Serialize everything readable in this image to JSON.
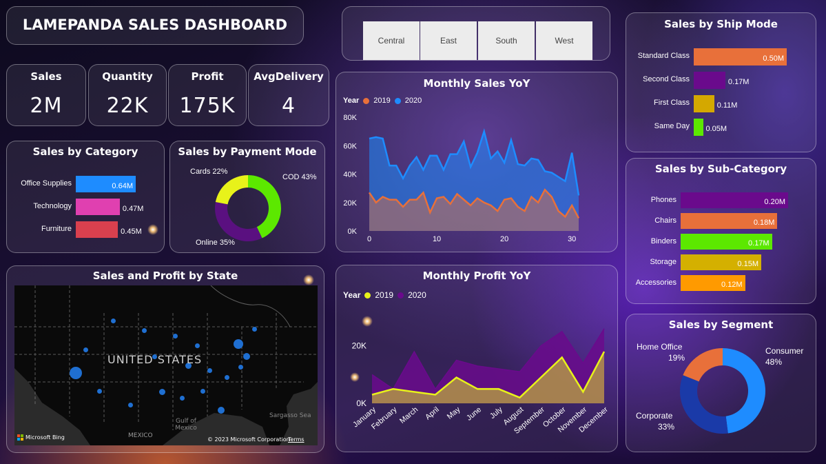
{
  "title": "LAMEPANDA SALES DASHBOARD",
  "regions": [
    "Central",
    "East",
    "South",
    "West"
  ],
  "kpis": [
    {
      "label": "Sales",
      "value": "2M"
    },
    {
      "label": "Quantity",
      "value": "22K"
    },
    {
      "label": "Profit",
      "value": "175K"
    },
    {
      "label": "AvgDelivery",
      "value": "4"
    }
  ],
  "colors": {
    "accent_orange": "#e8703a",
    "accent_blue": "#1e8cff",
    "accent_yellow": "#e8f21a",
    "accent_purple": "#6a0a8c"
  },
  "map": {
    "title": "Sales and Profit by State",
    "country_label": "UNITED STATES",
    "labels": [
      "Gulf of Mexico",
      "Sargasso Sea",
      "MEXICO"
    ],
    "brand": "Microsoft Bing",
    "copyright": "© 2023 Microsoft Corporation",
    "terms": "Terms"
  },
  "chart_data": [
    {
      "id": "category",
      "type": "bar",
      "title": "Sales by Category",
      "categories": [
        "Office Supplies",
        "Technology",
        "Furniture"
      ],
      "values": [
        0.64,
        0.47,
        0.45
      ],
      "labels": [
        "0.64M",
        "0.47M",
        "0.45M"
      ],
      "colors": [
        "#1e8cff",
        "#e040b0",
        "#d9404e"
      ]
    },
    {
      "id": "payment",
      "type": "pie",
      "title": "Sales by Payment Mode",
      "categories": [
        "COD",
        "Online",
        "Cards"
      ],
      "values": [
        43,
        35,
        22
      ],
      "labels": [
        "COD 43%",
        "Online 35%",
        "Cards 22%"
      ],
      "colors": [
        "#5ce800",
        "#5a1080",
        "#e8f21a"
      ]
    },
    {
      "id": "monthly_sales",
      "type": "area",
      "title": "Monthly Sales YoY",
      "legend_title": "Year",
      "x": [
        0,
        1,
        2,
        3,
        4,
        5,
        6,
        7,
        8,
        9,
        10,
        11,
        12,
        13,
        14,
        15,
        16,
        17,
        18,
        19,
        20,
        21,
        22,
        23,
        24,
        25,
        26,
        27,
        28,
        29,
        30,
        31
      ],
      "xticks": [
        "0",
        "10",
        "20",
        "30"
      ],
      "yticks": [
        "0K",
        "20K",
        "40K",
        "60K",
        "80K"
      ],
      "ylim": [
        0,
        80
      ],
      "xlim": [
        0,
        31
      ],
      "series": [
        {
          "name": "2019",
          "color": "#e8703a",
          "values": [
            27,
            20,
            24,
            22,
            22,
            17,
            22,
            22,
            27,
            13,
            23,
            24,
            19,
            26,
            22,
            18,
            23,
            20,
            18,
            14,
            22,
            23,
            17,
            14,
            24,
            20,
            29,
            24,
            14,
            10,
            18,
            9
          ]
        },
        {
          "name": "2020",
          "color": "#1e8cff",
          "values": [
            65,
            66,
            65,
            46,
            46,
            37,
            46,
            52,
            43,
            53,
            53,
            43,
            54,
            54,
            63,
            45,
            55,
            70,
            51,
            56,
            48,
            64,
            47,
            46,
            51,
            50,
            42,
            41,
            38,
            35,
            55,
            25
          ]
        }
      ]
    },
    {
      "id": "monthly_profit",
      "type": "area",
      "title": "Monthly Profit YoY",
      "legend_title": "Year",
      "categories": [
        "January",
        "February",
        "March",
        "April",
        "May",
        "June",
        "July",
        "August",
        "September",
        "October",
        "November",
        "December"
      ],
      "yticks": [
        "0K",
        "20K"
      ],
      "ylim": [
        0,
        30
      ],
      "series": [
        {
          "name": "2019",
          "color": "#e8f21a",
          "values": [
            3,
            5,
            4,
            3,
            9,
            5,
            5,
            2,
            9,
            16,
            4,
            18
          ]
        },
        {
          "name": "2020",
          "color": "#6a0a8c",
          "values": [
            10,
            5,
            18,
            5,
            15,
            13,
            12,
            11,
            20,
            25,
            14,
            26
          ]
        }
      ]
    },
    {
      "id": "ship_mode",
      "type": "bar",
      "title": "Sales by Ship Mode",
      "categories": [
        "Standard Class",
        "Second Class",
        "First Class",
        "Same Day"
      ],
      "values": [
        0.5,
        0.17,
        0.11,
        0.05
      ],
      "labels": [
        "0.50M",
        "0.17M",
        "0.11M",
        "0.05M"
      ],
      "colors": [
        "#e8703a",
        "#6a0a8c",
        "#d4a800",
        "#5ce800"
      ]
    },
    {
      "id": "sub_category",
      "type": "bar",
      "title": "Sales by Sub-Category",
      "categories": [
        "Phones",
        "Chairs",
        "Binders",
        "Storage",
        "Accessories"
      ],
      "values": [
        0.2,
        0.18,
        0.17,
        0.15,
        0.12
      ],
      "labels": [
        "0.20M",
        "0.18M",
        "0.17M",
        "0.15M",
        "0.12M"
      ],
      "colors": [
        "#6a0a8c",
        "#e8703a",
        "#5ce800",
        "#d4b000",
        "#ff9a00"
      ]
    },
    {
      "id": "segment",
      "type": "pie",
      "title": "Sales by Segment",
      "categories": [
        "Consumer",
        "Corporate",
        "Home Office"
      ],
      "values": [
        48,
        33,
        19
      ],
      "names": [
        "Consumer",
        "Corporate",
        "Home Office"
      ],
      "percents": [
        "48%",
        "33%",
        "19%"
      ],
      "colors": [
        "#1e8cff",
        "#1a3aa8",
        "#e8703a"
      ]
    }
  ]
}
